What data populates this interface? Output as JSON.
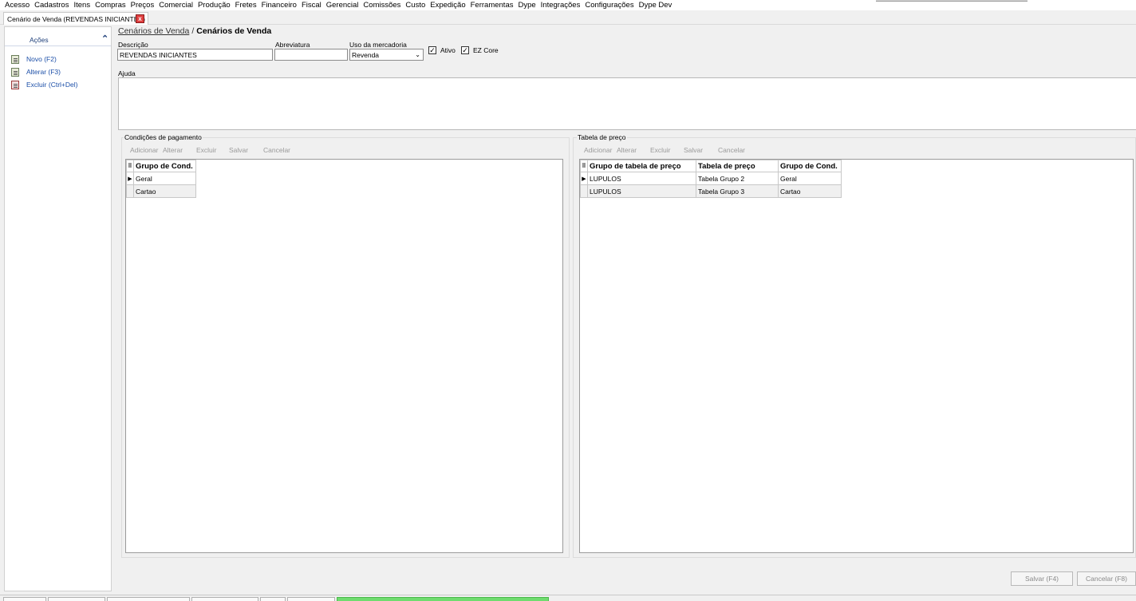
{
  "menu": [
    "Acesso",
    "Cadastros",
    "Itens",
    "Compras",
    "Preços",
    "Comercial",
    "Produção",
    "Fretes",
    "Financeiro",
    "Fiscal",
    "Gerencial",
    "Comissões",
    "Custo",
    "Expedição",
    "Ferramentas",
    "Dype",
    "Integrações",
    "Configurações",
    "Dype Dev"
  ],
  "doc_tab": {
    "label": "Cenário de Venda (REVENDAS INICIANTES)",
    "close": "x"
  },
  "sidebar": {
    "header": "Ações",
    "items": [
      {
        "label": "Novo (F2)",
        "icon": "new-document-icon"
      },
      {
        "label": "Alterar (F3)",
        "icon": "edit-document-icon"
      },
      {
        "label": "Excluir (Ctrl+Del)",
        "icon": "delete-document-icon"
      }
    ]
  },
  "breadcrumb": {
    "parent": "Cenários de Venda",
    "separator": "/",
    "current": "Cenários de Venda"
  },
  "form": {
    "descricao_label": "Descrição",
    "descricao_value": "REVENDAS INICIANTES",
    "abreviatura_label": "Abreviatura",
    "abreviatura_value": "",
    "uso_label": "Uso da mercadoria",
    "uso_value": "Revenda",
    "ativo_label": "Ativo",
    "ativo_checked": true,
    "ezcore_label": "EZ Core",
    "ezcore_checked": true,
    "ajuda_label": "Ajuda"
  },
  "condicoes": {
    "title": "Condições de pagamento",
    "toolbar": [
      "Adicionar",
      "Alterar",
      "Excluir",
      "Salvar",
      "Cancelar"
    ],
    "columns": [
      "Grupo de Cond."
    ],
    "rows": [
      [
        "Geral"
      ],
      [
        "Cartao"
      ]
    ]
  },
  "tabela": {
    "title": "Tabela de preço",
    "toolbar": [
      "Adicionar",
      "Alterar",
      "Excluir",
      "Salvar",
      "Cancelar"
    ],
    "columns": [
      "Grupo de tabela de preço",
      "Tabela de preço",
      "Grupo de Cond."
    ],
    "rows": [
      [
        "LUPULOS",
        "Tabela Grupo 2",
        "Geral"
      ],
      [
        "LUPULOS",
        "Tabela Grupo 3",
        "Cartao"
      ]
    ]
  },
  "footer": {
    "save": "Salvar (F4)",
    "cancel": "Cancelar (F8)"
  },
  "colors": {
    "link": "#1c4fa8",
    "header_text": "#1e3f7a",
    "active_task": "#6fdc6f",
    "close_red": "#e04040"
  }
}
